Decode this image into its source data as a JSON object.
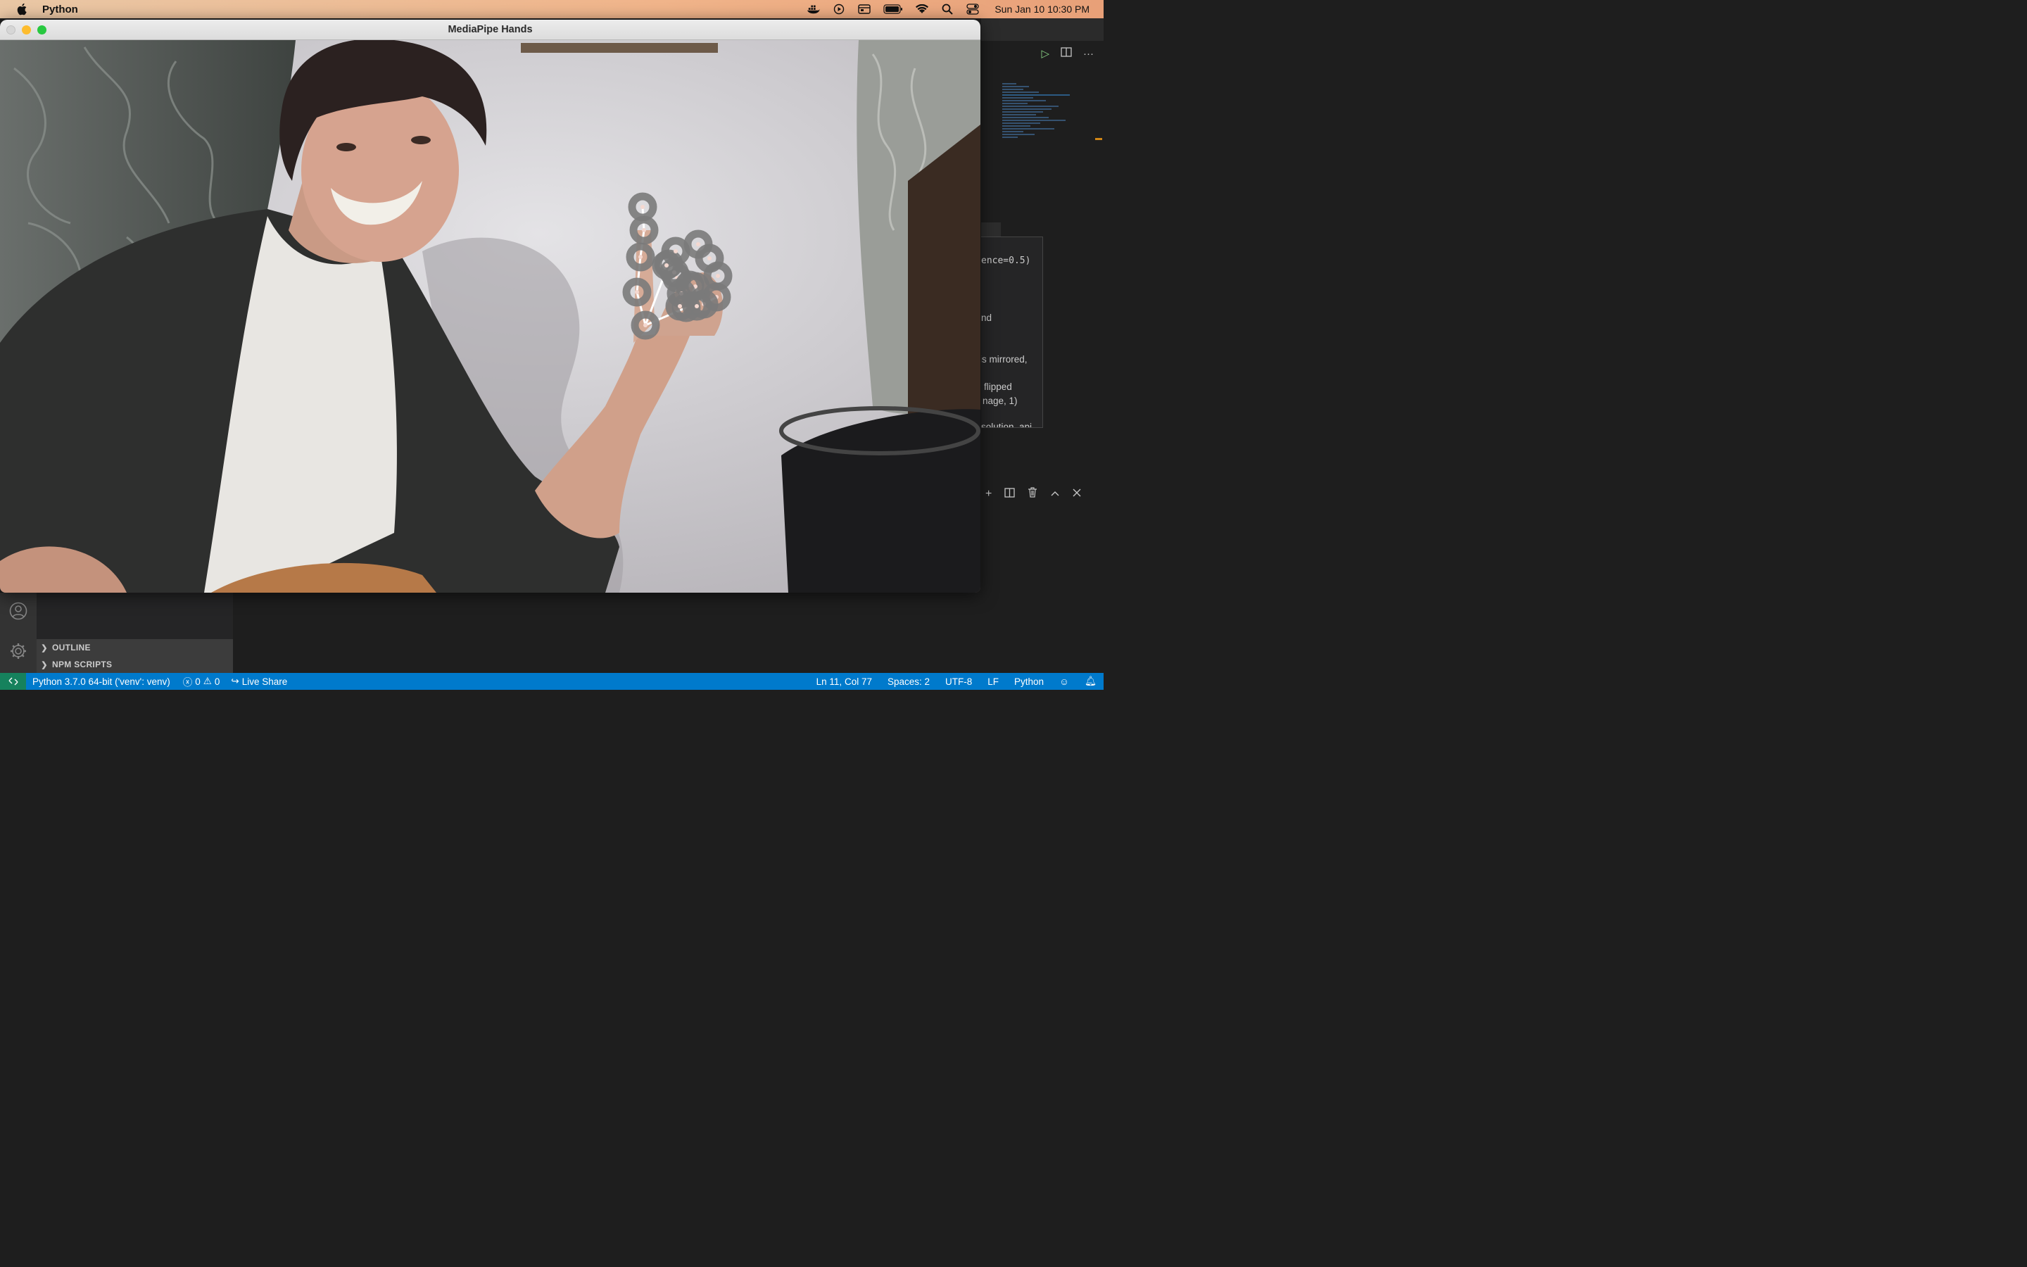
{
  "menubar": {
    "app_name": "Python",
    "clock": "Sun Jan 10  10:30 PM",
    "icons": [
      "apple-icon",
      "docker-icon",
      "play-circle-icon",
      "window-icon",
      "battery-icon",
      "wifi-icon",
      "spotlight-search-icon",
      "control-center-icon"
    ]
  },
  "window": {
    "title": "MediaPipe Hands"
  },
  "editor": {
    "toolbar_icons": [
      "run-icon",
      "split-editor-icon",
      "more-icon"
    ],
    "hover_lines": [
      "ence=0.5)",
      "nd",
      "is mirrored,",
      "flipped",
      "nage, 1)",
      "solution_api"
    ],
    "panel_icons": [
      "add-terminal-icon",
      "split-terminal-icon",
      "trash-icon",
      "maximize-panel-icon",
      "close-panel-icon"
    ]
  },
  "sidebar": {
    "sections": [
      "OUTLINE",
      "NPM SCRIPTS"
    ],
    "activity_icons": [
      "accounts-icon",
      "settings-gear-icon"
    ]
  },
  "statusbar": {
    "interpreter": "Python 3.7.0 64-bit ('venv': venv)",
    "errors": "0",
    "warnings": "0",
    "live_share": "Live Share",
    "cursor": "Ln 11, Col 77",
    "indent": "Spaces: 2",
    "encoding": "UTF-8",
    "eol": "LF",
    "language": "Python"
  },
  "colors": {
    "statusbar": "#007acc",
    "remote": "#16825d",
    "landmark": "#7a7a7a",
    "connection": "#ffffff"
  }
}
